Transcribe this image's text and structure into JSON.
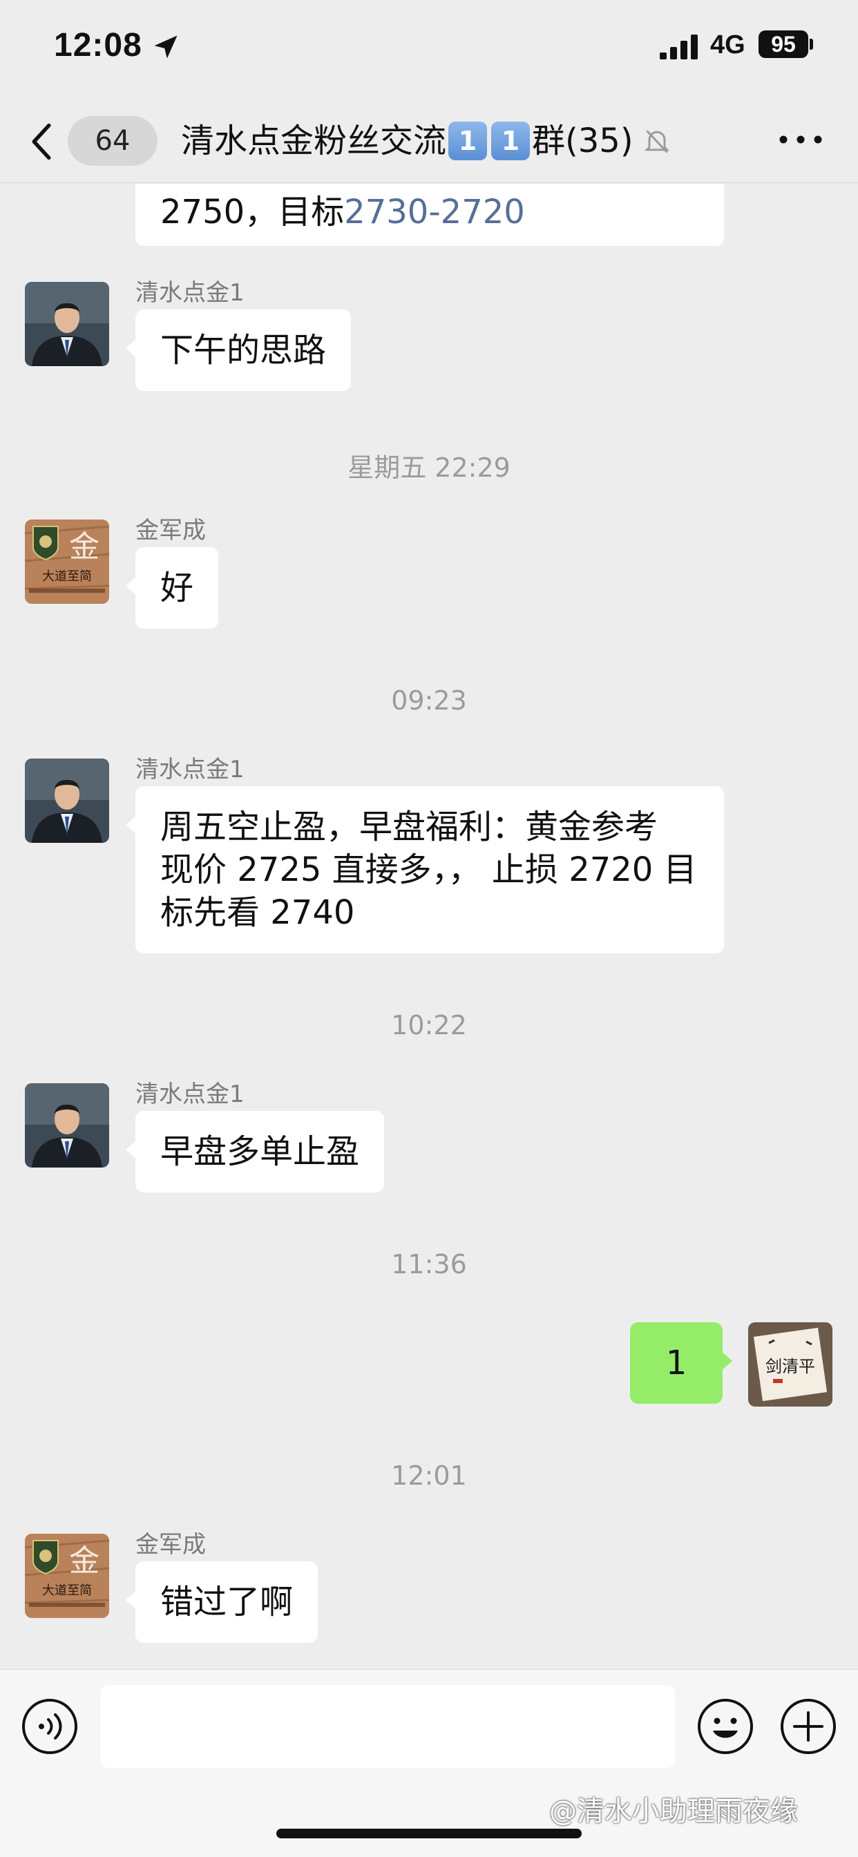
{
  "status_bar": {
    "time": "12:08",
    "network": "4G",
    "battery": "95"
  },
  "nav": {
    "back_count": "64",
    "title_prefix": "清水点金粉丝交流",
    "title_key1": "1",
    "title_key2": "1",
    "title_suffix": "群(35)"
  },
  "messages": {
    "m0": {
      "text_a": "2750，目标",
      "text_link": "2730-2720"
    },
    "m1": {
      "sender": "清水点金1",
      "text": "下午的思路"
    },
    "ts1": "星期五 22:29",
    "m2": {
      "sender": "金军成",
      "text": "好"
    },
    "ts2": "09:23",
    "m3": {
      "sender": "清水点金1",
      "line1": "周五空止盈，早盘福利：黄金参考",
      "line2": "现价 2725 直接多，， 止损 2720 目",
      "line3": "标先看 2740"
    },
    "ts3": "10:22",
    "m4": {
      "sender": "清水点金1",
      "text": "早盘多单止盈"
    },
    "ts4": "11:36",
    "m5": {
      "text": "1"
    },
    "ts5": "12:01",
    "m6": {
      "sender": "金军成",
      "text": "错过了啊"
    }
  },
  "avatars": {
    "jin_badge": "金",
    "jin_script": "大道至简",
    "me_text": "剑清平"
  },
  "watermark": "@清水小助理雨夜缘",
  "icons": {
    "location": "location-arrow-icon",
    "signal": "cellular-signal-icon",
    "back": "chevron-left-icon",
    "mute": "bell-slash-icon",
    "more": "ellipsis-icon",
    "voice": "voice-icon",
    "emoji": "emoji-icon",
    "plus": "plus-icon"
  },
  "colors": {
    "background": "#ededed",
    "bubble_self": "#95ec69",
    "link": "#566f98"
  }
}
